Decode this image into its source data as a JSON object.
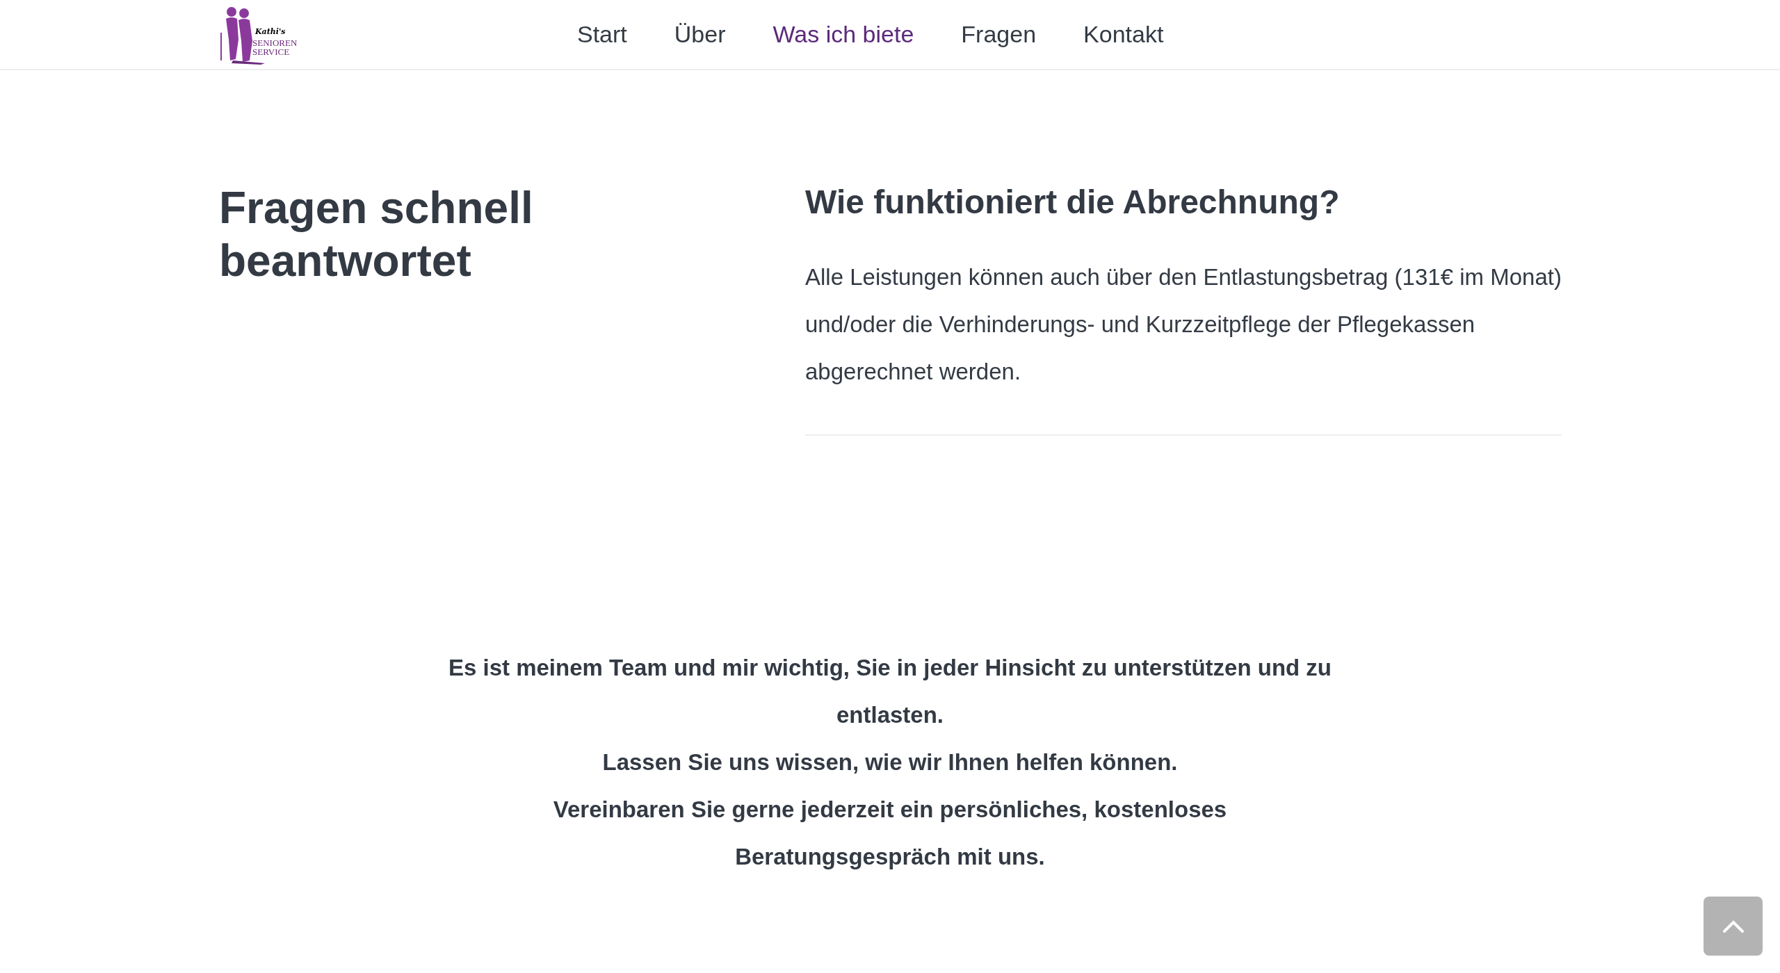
{
  "header": {
    "logo": {
      "script": "Kathi's",
      "line_1": "SENIOREN",
      "line_2": "SERVICE"
    },
    "nav": [
      {
        "label": "Start",
        "selected": false
      },
      {
        "label": "Über",
        "selected": false
      },
      {
        "label": "Was ich biete",
        "selected": true
      },
      {
        "label": "Fragen",
        "selected": false
      },
      {
        "label": "Kontakt",
        "selected": false
      }
    ]
  },
  "faq": {
    "title": "Fragen schnell beantwortet",
    "items": [
      {
        "question": "Wie funktioniert die Abrechnung?",
        "answer": "Alle Leistungen können auch über den Entlastungsbetrag (131€ im Monat) und/oder die Verhinderungs- und Kurzzeitpflege der Pflegekassen abgerechnet werden."
      }
    ]
  },
  "closing": [
    "Es ist meinem Team und mir wichtig, Sie in jeder Hinsicht zu unterstützen und zu entlasten.",
    "Lassen Sie uns wissen, wie wir Ihnen helfen können.",
    "Vereinbaren Sie gerne jederzeit ein persönliches, kostenloses Beratungsgespräch mit uns."
  ]
}
